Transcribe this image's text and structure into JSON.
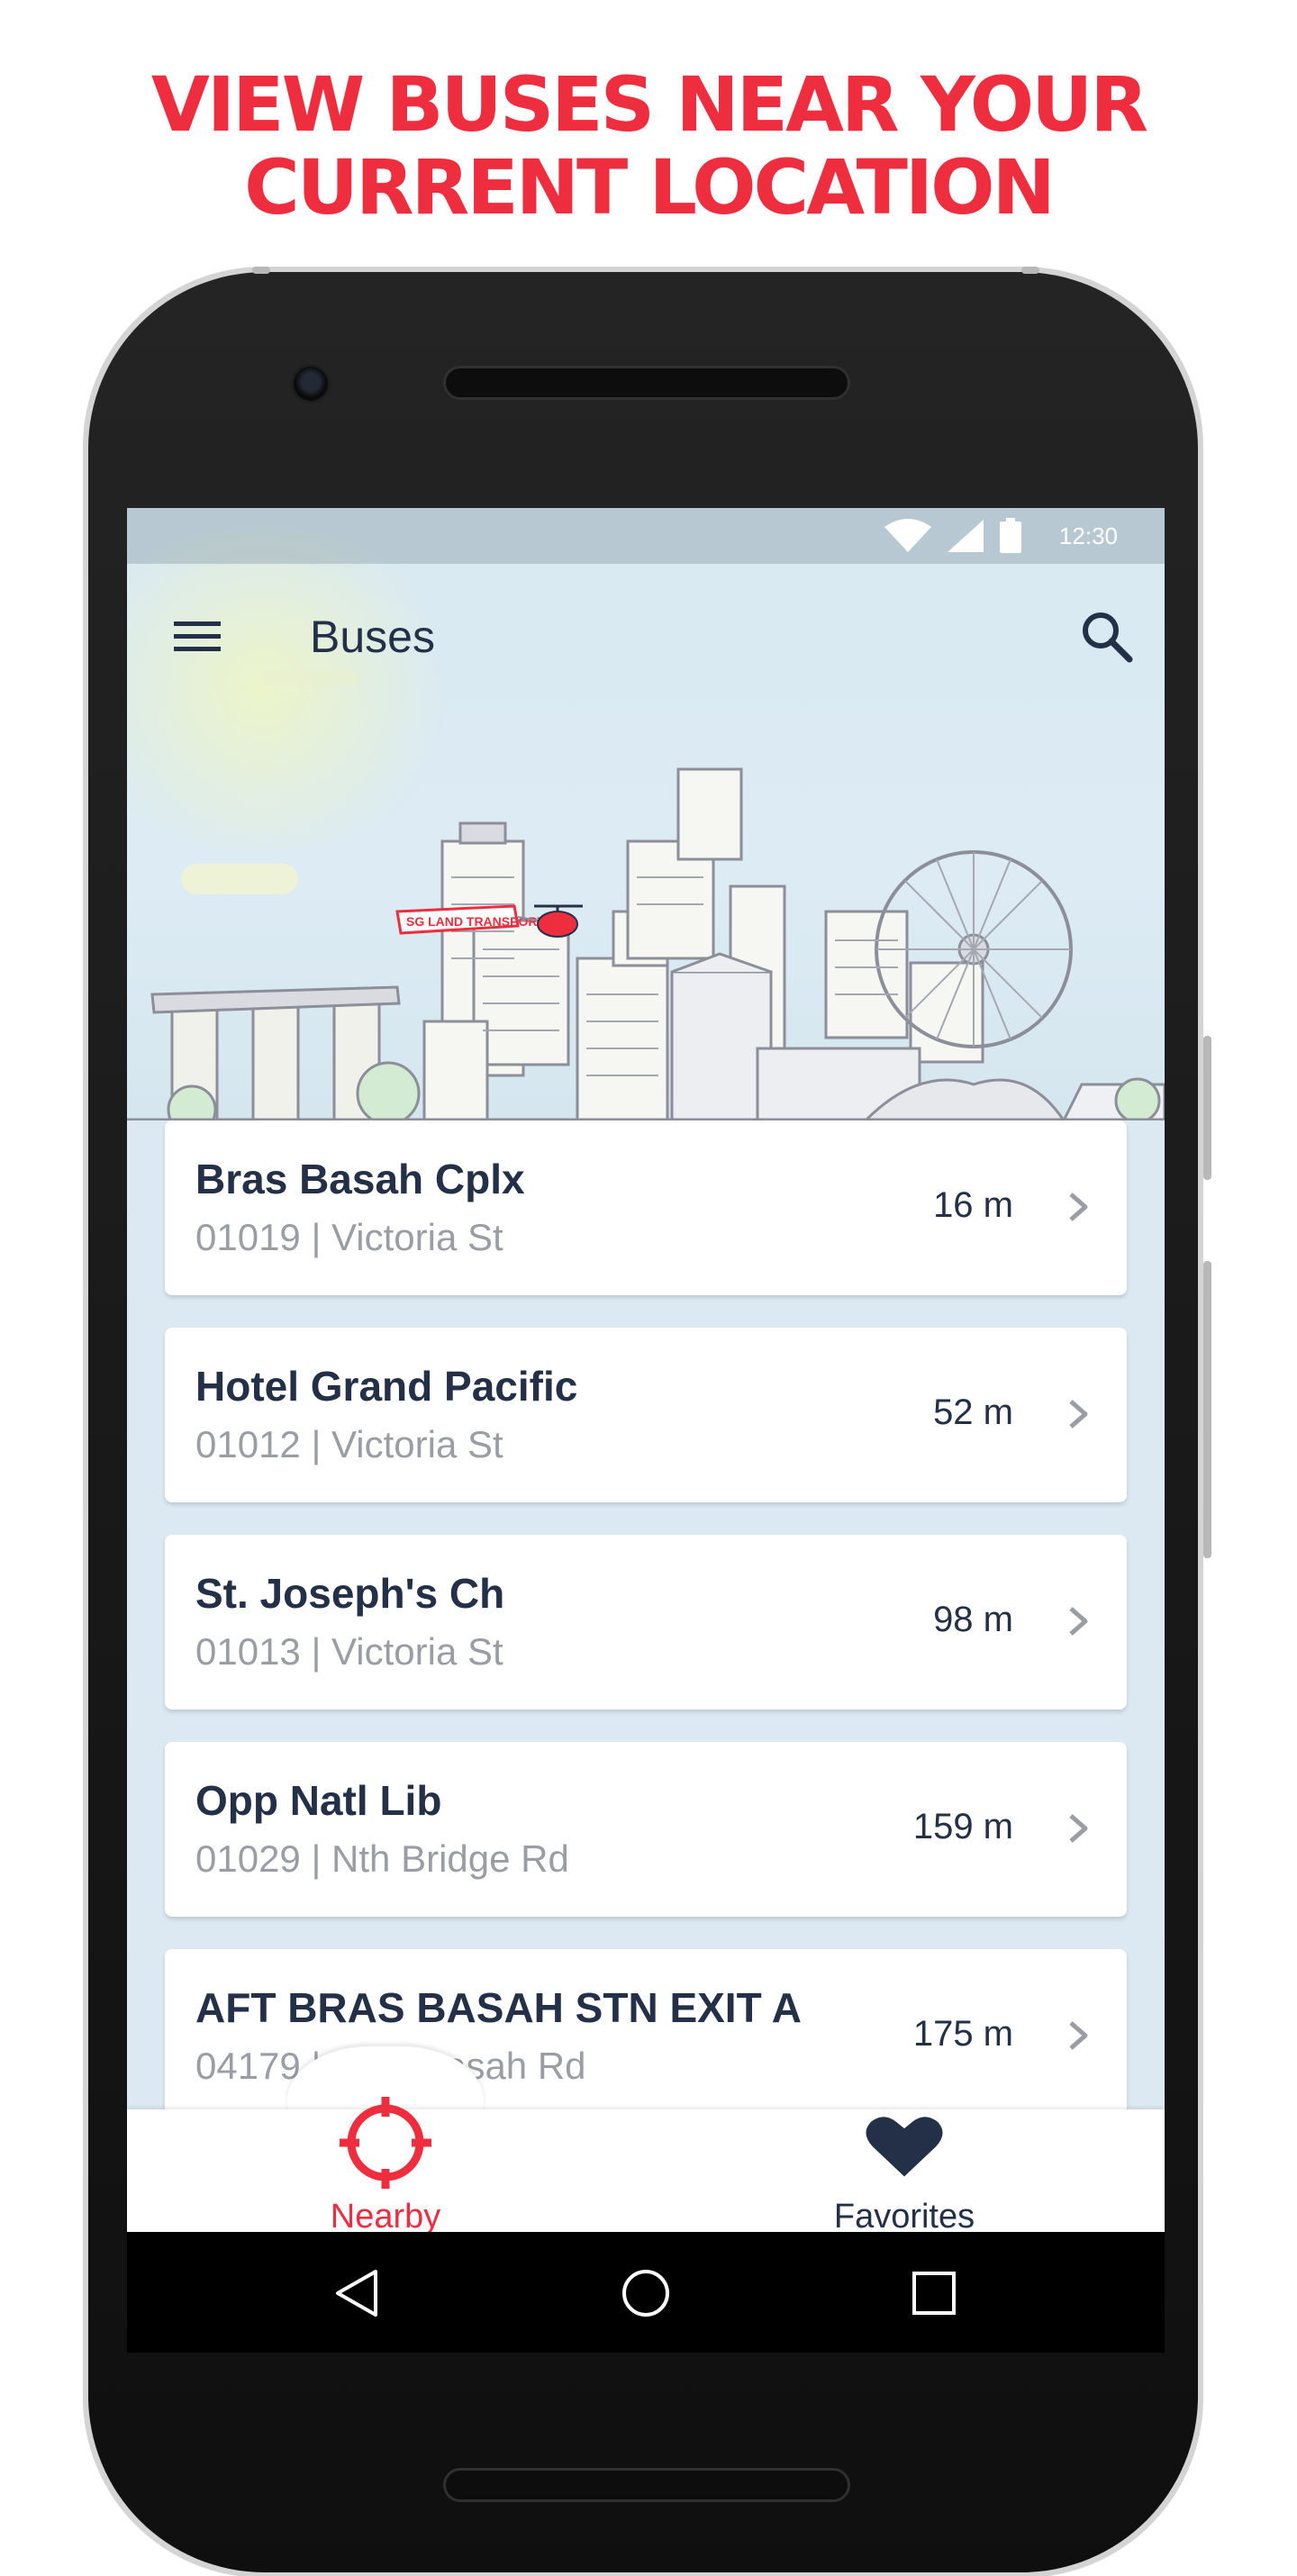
{
  "headline": {
    "line1": "VIEW BUSES NEAR YOUR",
    "line2": "CURRENT LOCATION"
  },
  "status_bar": {
    "time": "12:30",
    "icons": [
      "wifi-icon",
      "signal-icon",
      "battery-icon"
    ]
  },
  "app_bar": {
    "title": "Buses",
    "menu_icon": "hamburger-menu-icon",
    "search_icon": "search-icon"
  },
  "hero": {
    "banner_text": "SG LAND TRANSPORT"
  },
  "bus_stops": [
    {
      "name": "Bras Basah Cplx",
      "code_road": "01019 | Victoria St",
      "distance": "16 m"
    },
    {
      "name": "Hotel Grand Pacific",
      "code_road": "01012 | Victoria St",
      "distance": "52 m"
    },
    {
      "name": "St. Joseph's Ch",
      "code_road": "01013 | Victoria St",
      "distance": "98 m"
    },
    {
      "name": "Opp Natl Lib",
      "code_road": "01029 | Nth Bridge Rd",
      "distance": "159 m"
    },
    {
      "name": "AFT BRAS BASAH STN EXIT A",
      "code_road": "04179 | Bras Basah Rd",
      "distance": "175 m"
    }
  ],
  "bottom_nav": {
    "nearby_label": "Nearby",
    "favorites_label": "Favorites",
    "active": "Nearby"
  },
  "colors": {
    "accent": "#ee2d3e",
    "navy": "#233047",
    "subtext": "#9a9ea4",
    "screen_bg": "#dde9f2"
  }
}
